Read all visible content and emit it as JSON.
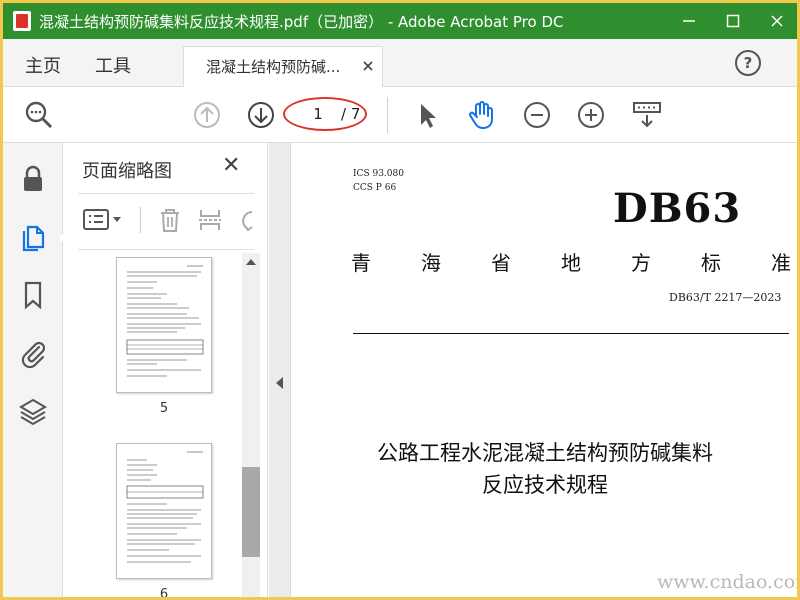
{
  "window": {
    "title": "混凝土结构预防碱集料反应技术规程.pdf（已加密） - Adobe Acrobat Pro DC",
    "minimize_icon": "minimize-icon",
    "maximize_icon": "maximize-icon",
    "close_icon": "close-icon"
  },
  "tabs": {
    "home": "主页",
    "tools": "工具",
    "document": "混凝土结构预防碱...",
    "help": "?"
  },
  "toolbar": {
    "current_page": "1",
    "total_pages": "/ 7",
    "highlight_color": "#d9342b"
  },
  "thumbnails": {
    "title": "页面缩略图",
    "close": "✕",
    "pages": [
      "5",
      "6"
    ]
  },
  "document": {
    "ics": "ICS  93.080",
    "ccs": "CCS  P  66",
    "code": "DB63",
    "org_chars": [
      "青",
      "海",
      "省",
      "地",
      "方",
      "标",
      "准"
    ],
    "std_number": "DB63/T  2217—2023",
    "title_line1": "公路工程水泥混凝土结构预防碱集料",
    "title_line2": "反应技术规程"
  },
  "watermark": "www.cndao.com",
  "colors": {
    "titlebar": "#2f8f2f",
    "accent_blue": "#1473e6",
    "frame_border": "#f2c94c"
  }
}
